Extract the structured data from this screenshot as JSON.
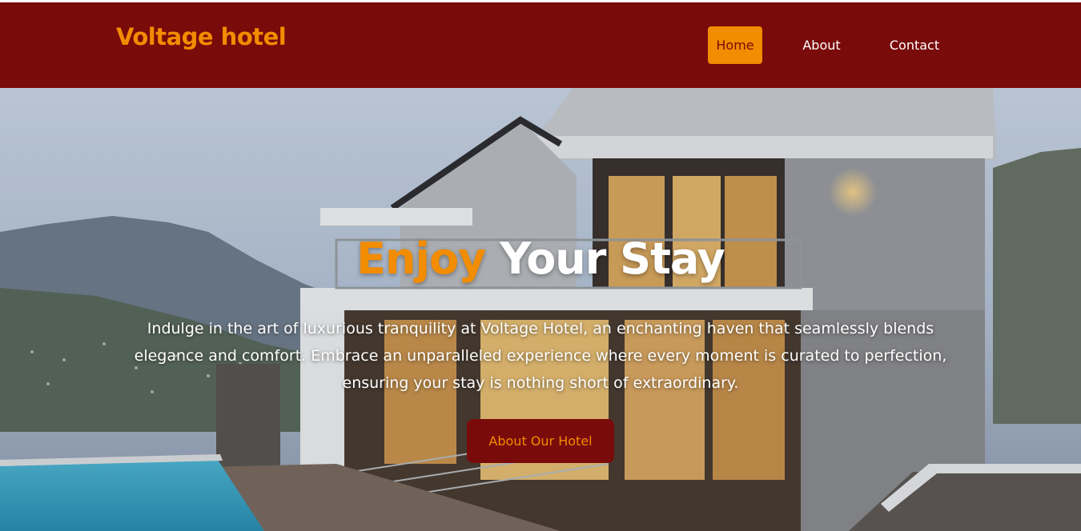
{
  "brand": {
    "name": "Voltage hotel"
  },
  "nav": {
    "items": [
      {
        "label": "Home",
        "active": true
      },
      {
        "label": "About",
        "active": false
      },
      {
        "label": "Contact",
        "active": false
      }
    ]
  },
  "hero": {
    "title_accent": "Enjoy",
    "title_rest": "Your Stay",
    "description": "Indulge in the art of luxurious tranquility at Voltage Hotel, an enchanting haven that seamlessly blends elegance and comfort. Embrace an unparalleled experience where every moment is curated to perfection, ensuring your stay is nothing short of extraordinary.",
    "button_label": "About Our Hotel",
    "background_image": "modern-hotel-villa-with-pool-and-mountains"
  },
  "colors": {
    "navbar_bg": "#7a0b0b",
    "accent": "#f28c00",
    "text_light": "#ffffff"
  }
}
